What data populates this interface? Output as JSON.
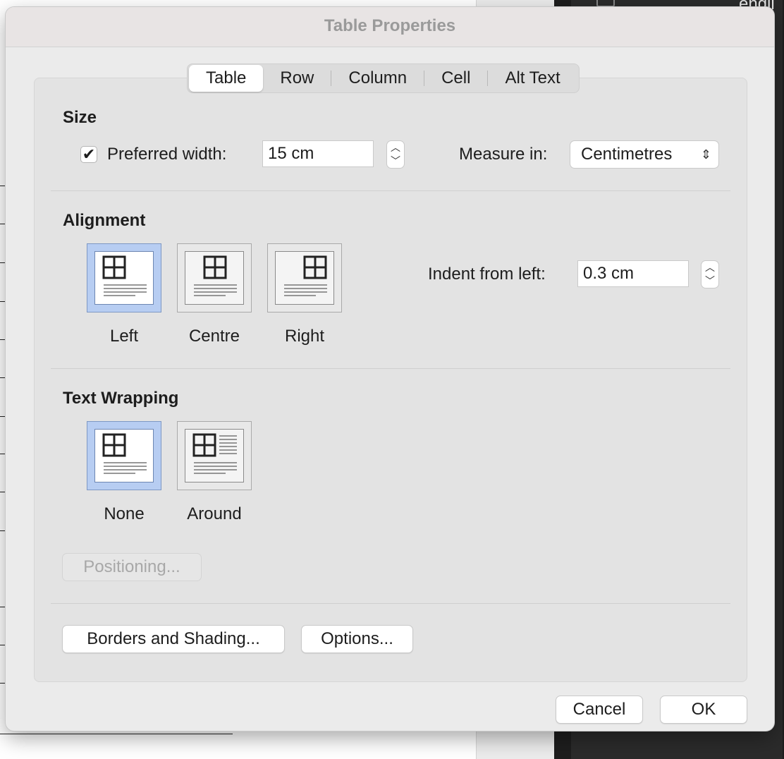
{
  "dialog": {
    "title": "Table Properties"
  },
  "tabs": [
    {
      "label": "Table",
      "active": true
    },
    {
      "label": "Row",
      "active": false
    },
    {
      "label": "Column",
      "active": false
    },
    {
      "label": "Cell",
      "active": false
    },
    {
      "label": "Alt Text",
      "active": false
    }
  ],
  "size": {
    "title": "Size",
    "preferred_width_checked": true,
    "preferred_width_label": "Preferred width:",
    "preferred_width_value": "15 cm",
    "measure_in_label": "Measure in:",
    "measure_in_value": "Centimetres"
  },
  "alignment": {
    "title": "Alignment",
    "options": [
      "Left",
      "Centre",
      "Right"
    ],
    "selected": "Left",
    "indent_label": "Indent from left:",
    "indent_value": "0.3 cm"
  },
  "text_wrapping": {
    "title": "Text Wrapping",
    "options": [
      "None",
      "Around"
    ],
    "selected": "None",
    "positioning_label": "Positioning..."
  },
  "buttons": {
    "borders_shading": "Borders and Shading...",
    "options": "Options...",
    "cancel": "Cancel",
    "ok": "OK"
  },
  "background": {
    "top_right_text": "engli"
  },
  "icons": {
    "check": "checkmark-icon",
    "stepper": "stepper-arrows-icon",
    "select_chevron": "updown-chevron-icon",
    "table": "table-grid-icon"
  },
  "colors": {
    "selected_fill": "#b7cdf2",
    "dialog_bg": "#ebebeb",
    "title_text": "#9a9a9a"
  }
}
